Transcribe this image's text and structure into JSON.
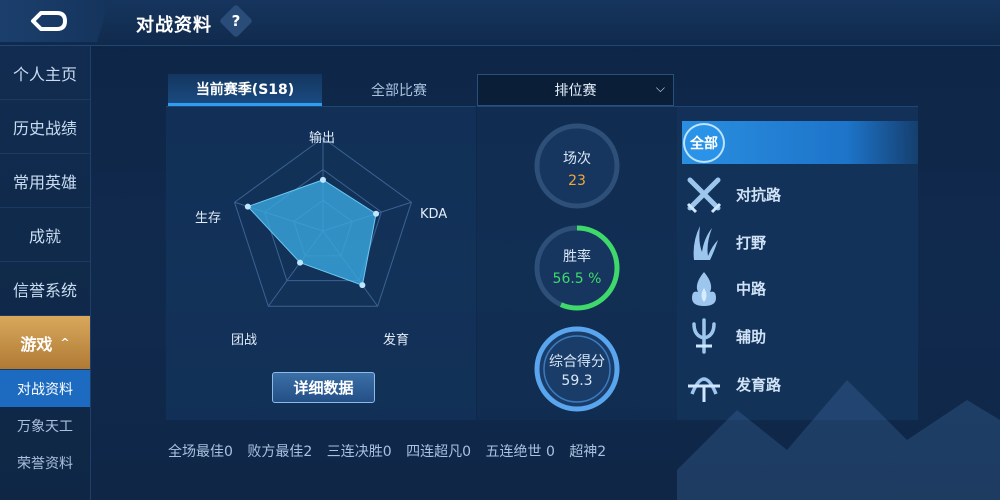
{
  "header": {
    "title": "对战资料",
    "help_label": "?"
  },
  "sidebar": {
    "items": [
      {
        "label": "个人主页"
      },
      {
        "label": "历史战绩"
      },
      {
        "label": "常用英雄"
      },
      {
        "label": "成就"
      },
      {
        "label": "信誉系统"
      },
      {
        "label": "游戏",
        "expanded": true
      }
    ],
    "subitems": [
      {
        "label": "对战资料",
        "active": true
      },
      {
        "label": "万象天工"
      },
      {
        "label": "荣誉资料"
      }
    ],
    "expand_glyph": "^"
  },
  "tabs": [
    {
      "label": "当前赛季(S18)",
      "active": true
    },
    {
      "label": "全部比赛",
      "active": false
    }
  ],
  "mode_select": {
    "selected": "排位赛"
  },
  "radar": {
    "labels": {
      "top": "输出",
      "right": "KDA",
      "bottom_right": "发育",
      "bottom_left": "团战",
      "left": "生存"
    },
    "values": {
      "output": 0.55,
      "kda": 0.6,
      "growth": 0.72,
      "teamfight": 0.42,
      "survival": 0.85
    },
    "detail_button": "详细数据"
  },
  "stats": {
    "matches": {
      "label": "场次",
      "value": "23"
    },
    "win_rate": {
      "label": "胜率",
      "value": "56.5 %",
      "fraction": 0.565
    },
    "score": {
      "label": "综合得分",
      "value": "59.3"
    }
  },
  "lanes": {
    "all_label": "全部",
    "items": [
      {
        "label": "对抗路",
        "icon": "crossed-swords-icon"
      },
      {
        "label": "打野",
        "icon": "claw-icon"
      },
      {
        "label": "中路",
        "icon": "flame-icon"
      },
      {
        "label": "辅助",
        "icon": "trident-icon"
      },
      {
        "label": "发育路",
        "icon": "bow-icon"
      }
    ]
  },
  "achievements": [
    "全场最佳0",
    "败方最佳2",
    "三连决胜0",
    "四连超凡0",
    "五连绝世 0",
    "超神2"
  ],
  "colors": {
    "accent": "#2f9df2",
    "active_nav": "#c8924a",
    "win_green": "#3fd96b",
    "matches_orange": "#f0a93a",
    "radar_fill": "#3aa8e0"
  }
}
